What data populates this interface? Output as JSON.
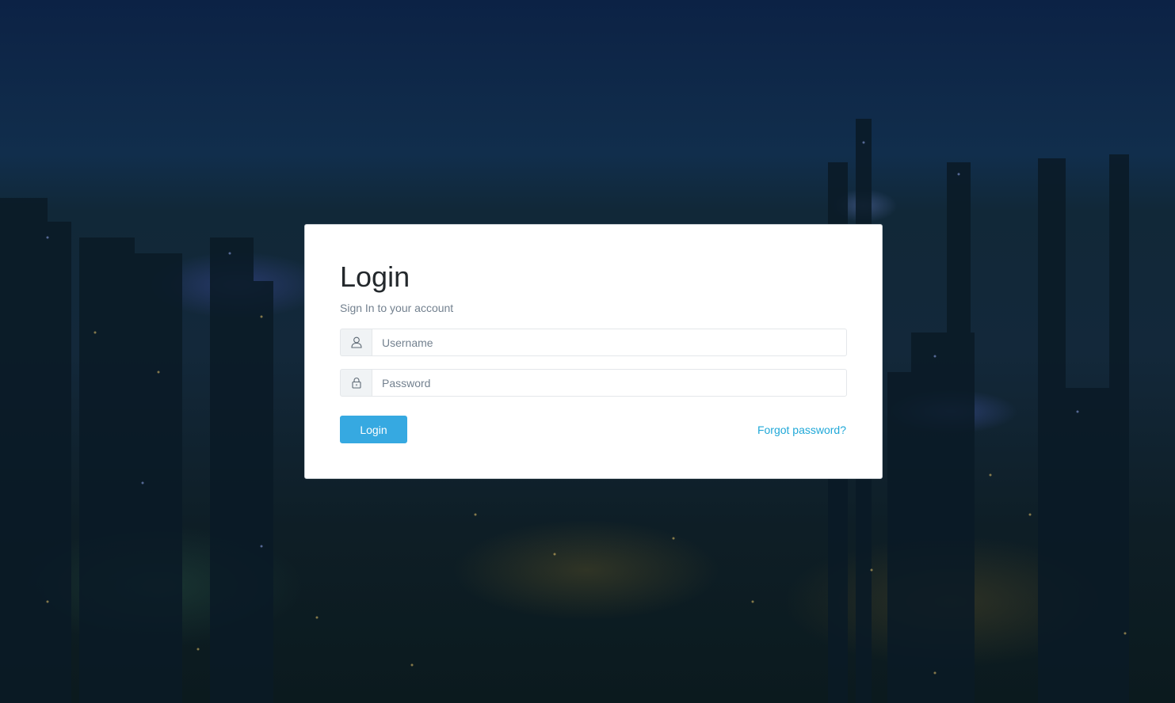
{
  "login": {
    "title": "Login",
    "subtitle": "Sign In to your account",
    "username": {
      "placeholder": "Username",
      "value": "",
      "icon": "user-icon"
    },
    "password": {
      "placeholder": "Password",
      "value": "",
      "icon": "lock-icon"
    },
    "login_button": "Login",
    "forgot_link": "Forgot password?"
  },
  "colors": {
    "primary": "#36a9e1",
    "link": "#20a8d8",
    "title": "#23282c",
    "muted": "#73818f",
    "card_bg": "#ffffff",
    "background": "#0f2638"
  }
}
